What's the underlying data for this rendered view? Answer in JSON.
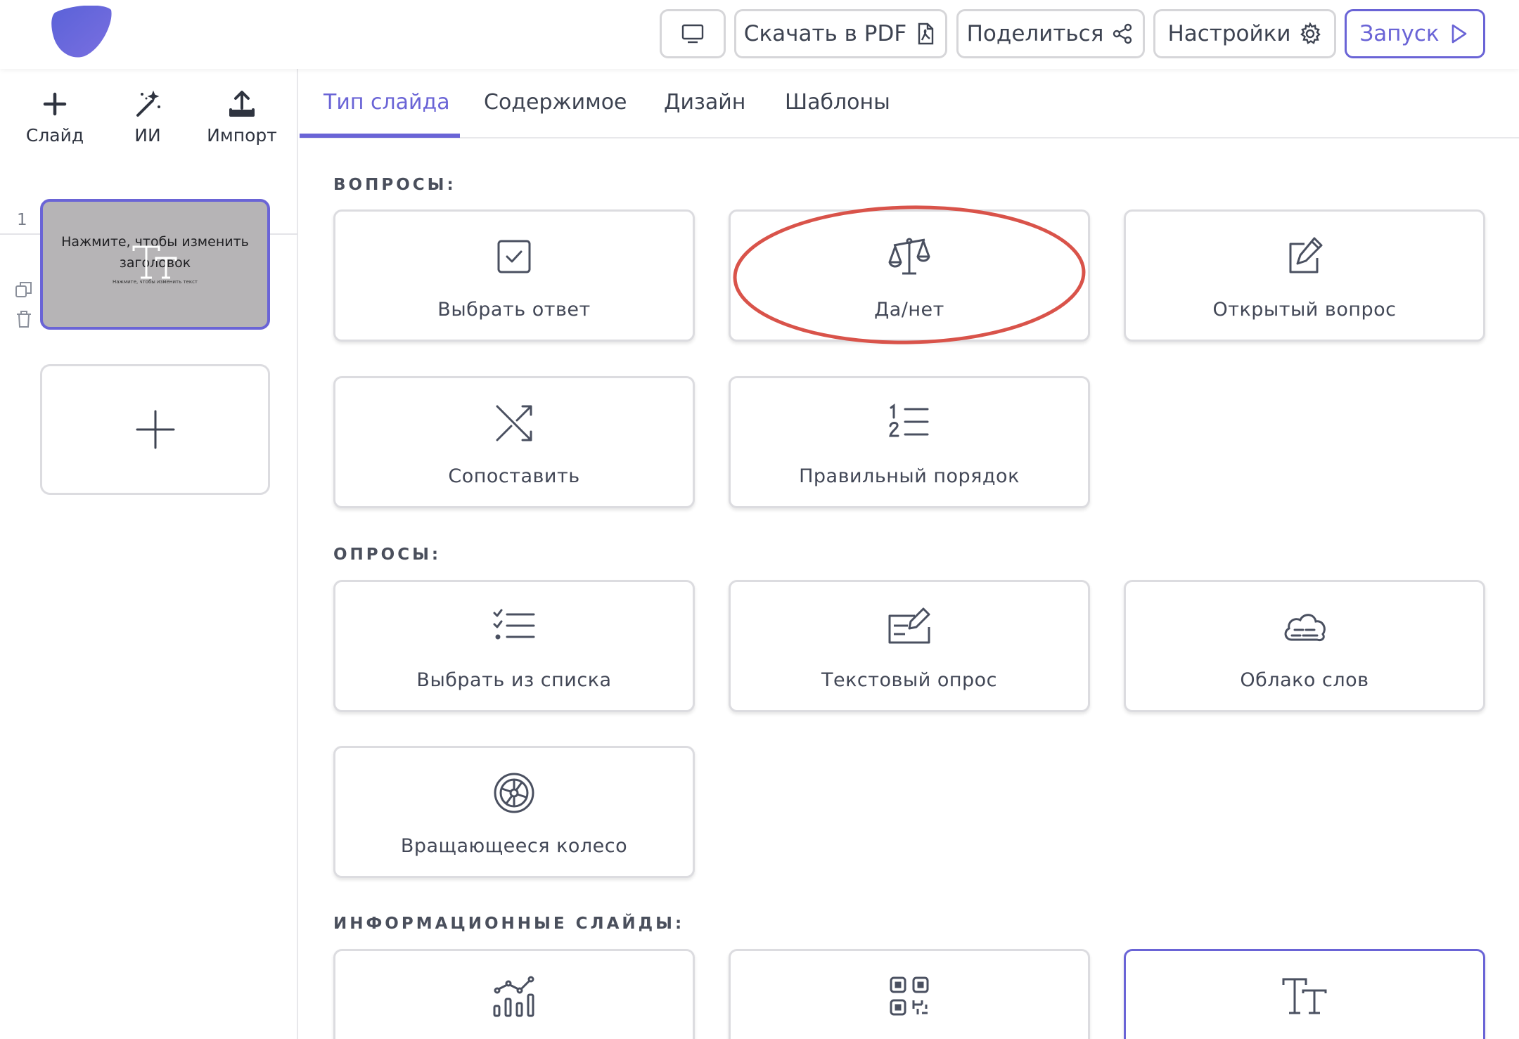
{
  "header": {
    "download_pdf": "Скачать в PDF",
    "share": "Поделиться",
    "settings": "Настройки",
    "launch": "Запуск",
    "accent_color": "#6a64d6"
  },
  "sidebar": {
    "tools": [
      {
        "label": "Слайд",
        "icon": "plus-icon"
      },
      {
        "label": "ИИ",
        "icon": "magic-wand-icon"
      },
      {
        "label": "Импорт",
        "icon": "upload-icon"
      }
    ],
    "slides": [
      {
        "number": "1",
        "title": "Нажмите, чтобы изменить заголовок",
        "subtitle": "Нажмите, чтобы изменить текст"
      }
    ]
  },
  "tabs": [
    {
      "label": "Тип слайда",
      "active": true
    },
    {
      "label": "Содержимое",
      "active": false
    },
    {
      "label": "Дизайн",
      "active": false
    },
    {
      "label": "Шаблоны",
      "active": false
    }
  ],
  "sections": {
    "questions": {
      "title": "ВОПРОСЫ:",
      "cards": [
        {
          "label": "Выбрать ответ",
          "icon": "checkbox-icon"
        },
        {
          "label": "Да/нет",
          "icon": "scales-icon"
        },
        {
          "label": "Открытый вопрос",
          "icon": "edit-icon"
        },
        {
          "label": "Сопоставить",
          "icon": "shuffle-icon"
        },
        {
          "label": "Правильный порядок",
          "icon": "numbered-list-icon"
        }
      ]
    },
    "polls": {
      "title": "ОПРОСЫ:",
      "cards": [
        {
          "label": "Выбрать из списка",
          "icon": "checklist-icon"
        },
        {
          "label": "Текстовый опрос",
          "icon": "text-poll-icon"
        },
        {
          "label": "Облако слов",
          "icon": "cloud-icon"
        },
        {
          "label": "Вращающееся колесо",
          "icon": "wheel-icon"
        }
      ]
    },
    "info": {
      "title": "ИНФОРМАЦИОННЫЕ СЛАЙДЫ:",
      "cards": [
        {
          "label": "",
          "icon": "chart-icon"
        },
        {
          "label": "",
          "icon": "qr-code-icon"
        },
        {
          "label": "",
          "icon": "text-tt-icon"
        }
      ]
    }
  },
  "annotation_color": "#d9534a"
}
